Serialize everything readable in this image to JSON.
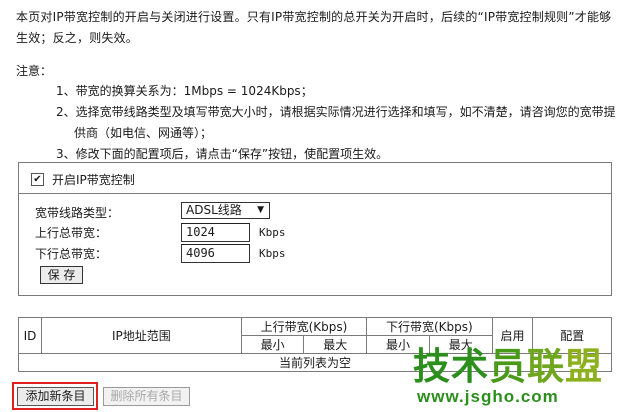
{
  "intro": {
    "line1": "本页对IP带宽控制的开启与关闭进行设置。只有IP带宽控制的总开关为开启时，后续的“IP带宽控制规则”才能够",
    "line2": "生效；反之，则失效。"
  },
  "notes": {
    "title": "注意：",
    "item1": "1、带宽的换算关系为：1Mbps = 1024Kbps；",
    "item2a": "2、选择宽带线路类型及填写带宽大小时，请根据实际情况进行选择和填写，如不清楚，请咨询您的宽带提",
    "item2b": "供商（如电信、网通等）；",
    "item3": "3、修改下面的配置项后，请点击“保存”按钮，使配置项生效。"
  },
  "control": {
    "enable_label": "开启IP带宽控制",
    "enabled": true,
    "checkmark": "✔"
  },
  "form": {
    "line_type_label": "宽带线路类型：",
    "line_type_value": "ADSL线路",
    "up_label": "上行总带宽：",
    "up_value": "1024",
    "up_unit": "Kbps",
    "down_label": "下行总带宽：",
    "down_value": "4096",
    "down_unit": "Kbps",
    "save_label": "保 存"
  },
  "table": {
    "col_id": "ID",
    "col_ip": "IP地址范围",
    "col_up": "上行带宽(Kbps)",
    "col_down": "下行带宽(Kbps)",
    "col_enable": "启用",
    "col_config": "配置",
    "sub_min": "最小",
    "sub_max": "最大",
    "empty_text": "当前列表为空"
  },
  "actions": {
    "add_label": "添加新条目",
    "delete_all_label": "删除所有条目"
  },
  "watermark": {
    "c1": "技",
    "c2": "术",
    "c3": "员",
    "c4": "联",
    "c5": "盟",
    "url": "www.jsgho.com"
  }
}
